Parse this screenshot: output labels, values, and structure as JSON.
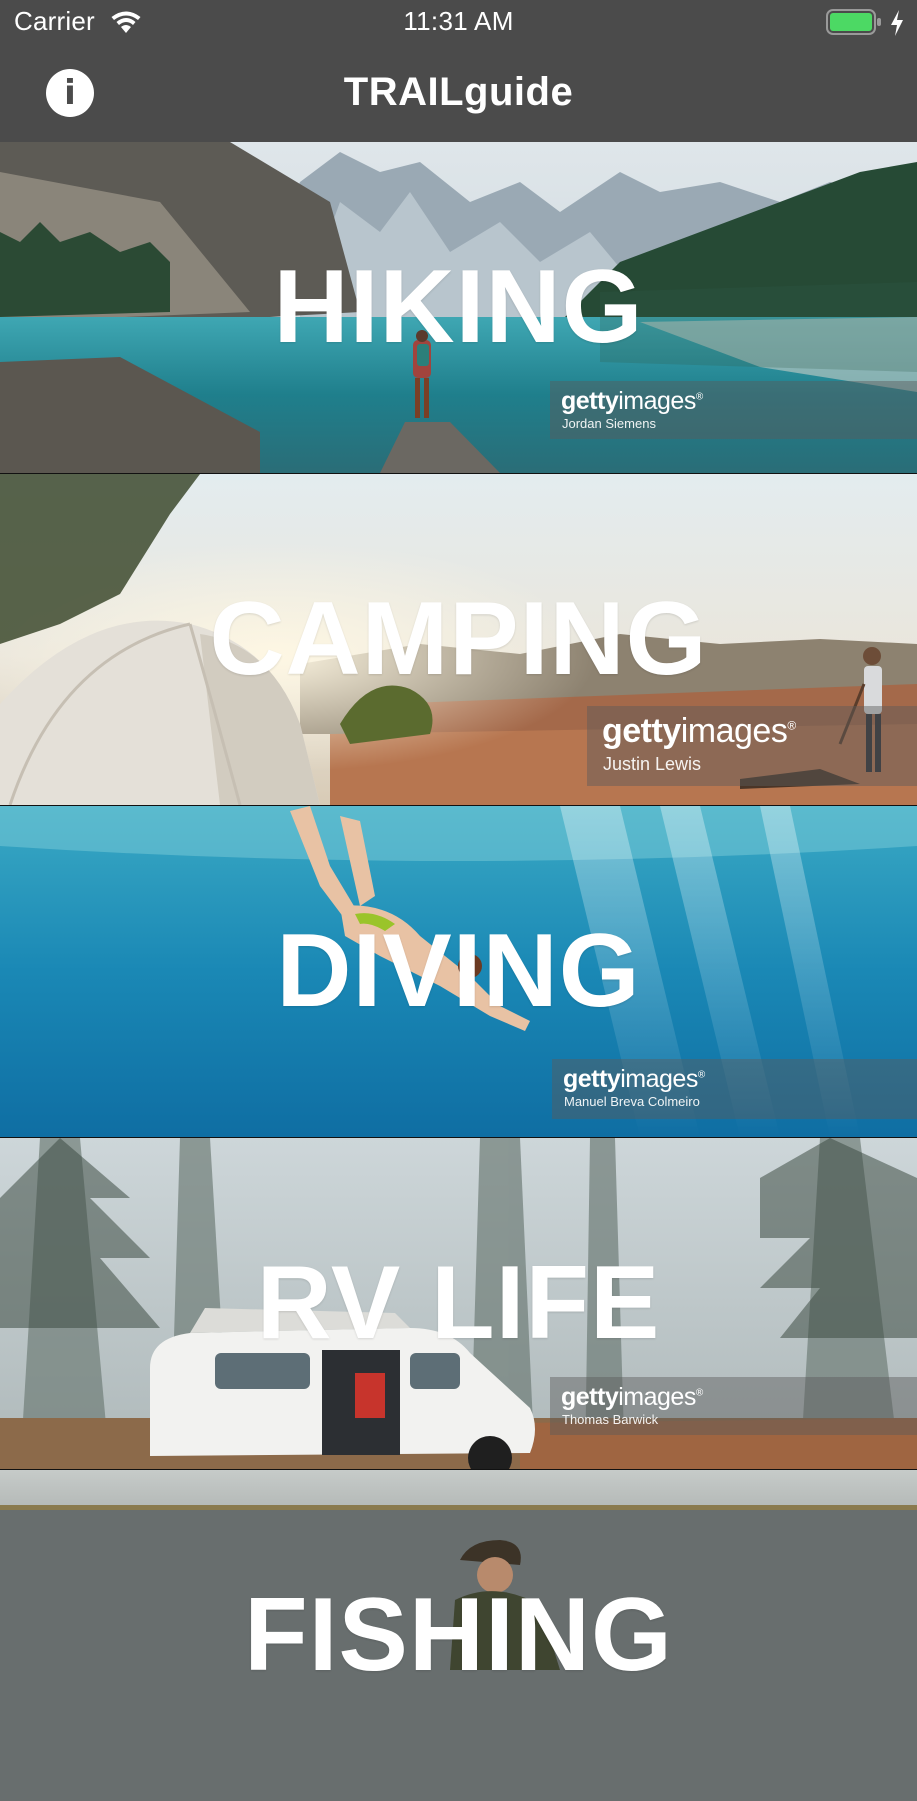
{
  "status_bar": {
    "carrier": "Carrier",
    "time": "11:31 AM",
    "battery_color": "#4cd964",
    "icons": [
      "wifi-icon",
      "battery-icon",
      "charging-icon"
    ]
  },
  "nav": {
    "title": "TRAILguide",
    "info_glyph": "i",
    "background": "#4b4b4b"
  },
  "activities": [
    {
      "label": "HIKING",
      "credit_brand_bold": "getty",
      "credit_brand": "images",
      "credit_mark": "®",
      "photographer": "Jordan Siemens"
    },
    {
      "label": "CAMPING",
      "credit_brand_bold": "getty",
      "credit_brand": "images",
      "credit_mark": "®",
      "photographer": "Justin Lewis"
    },
    {
      "label": "DIVING",
      "credit_brand_bold": "getty",
      "credit_brand": "images",
      "credit_mark": "®",
      "photographer": "Manuel Breva Colmeiro"
    },
    {
      "label": "RV LIFE",
      "credit_brand_bold": "getty",
      "credit_brand": "images",
      "credit_mark": "®",
      "photographer": "Thomas Barwick"
    },
    {
      "label": "FISHING"
    }
  ]
}
